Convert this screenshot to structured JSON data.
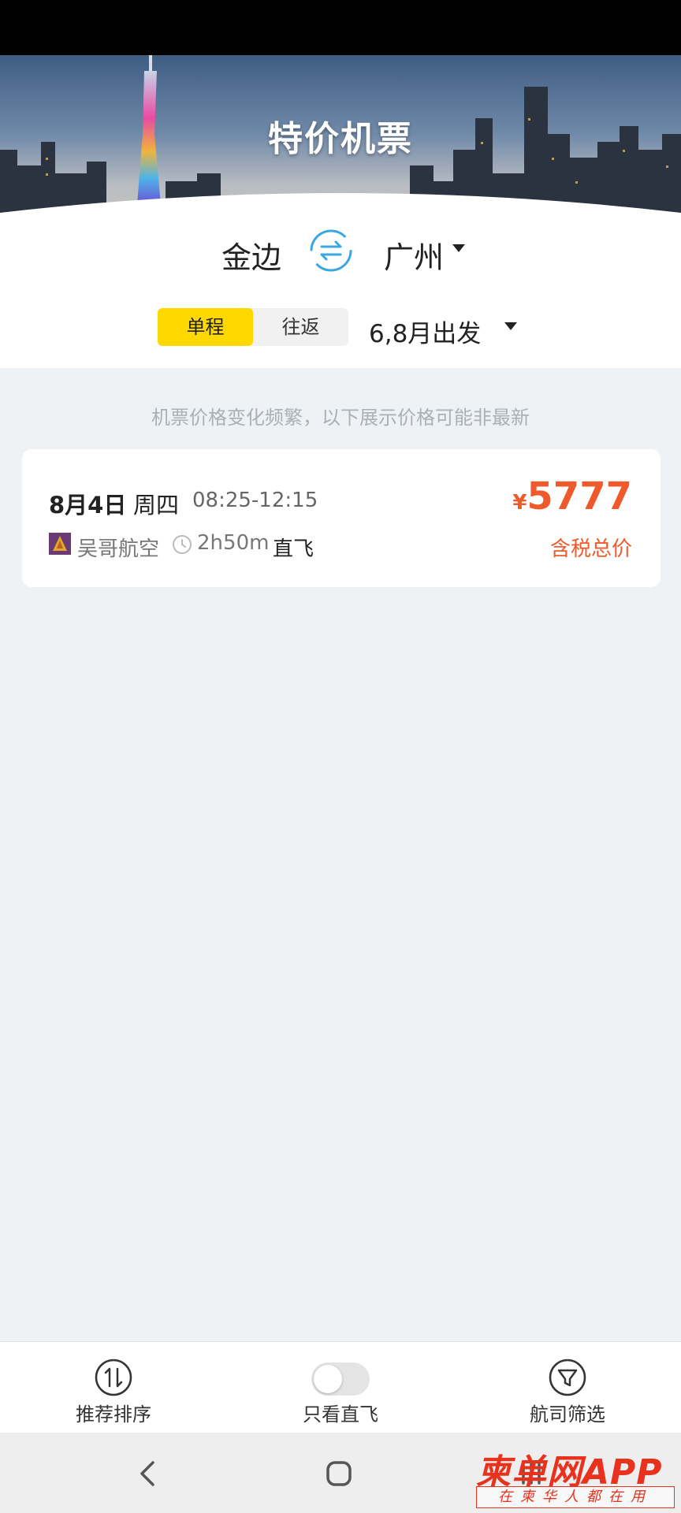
{
  "banner": {
    "title": "特价机票"
  },
  "route": {
    "from_city": "金边",
    "to_city": "广州"
  },
  "trip_type": {
    "options": [
      "单程",
      "往返"
    ],
    "selected": "单程"
  },
  "departure": {
    "label": "6,8月出发"
  },
  "notice": "机票价格变化频繁，以下展示价格可能非最新",
  "flights": [
    {
      "date": "8月4日",
      "weekday": "周四",
      "time": "08:25-12:15",
      "airline": "吴哥航空",
      "duration": "2h50m",
      "type": "直飞",
      "currency": "¥",
      "price": "5777",
      "price_note": "含税总价"
    }
  ],
  "bottom_bar": {
    "sort_label": "推荐排序",
    "direct_only_label": "只看直飞",
    "direct_only_on": false,
    "airline_filter_label": "航司筛选"
  },
  "watermark": {
    "main": "柬单网APP",
    "sub": "在柬华人都在用"
  },
  "colors": {
    "accent_yellow": "#ffd800",
    "price_orange": "#ee5a2b",
    "swap_blue": "#3aa7e0"
  },
  "icons": [
    "swap-icon",
    "clock-icon",
    "sort-icon",
    "filter-icon",
    "back-icon",
    "home-icon",
    "recents-icon"
  ]
}
